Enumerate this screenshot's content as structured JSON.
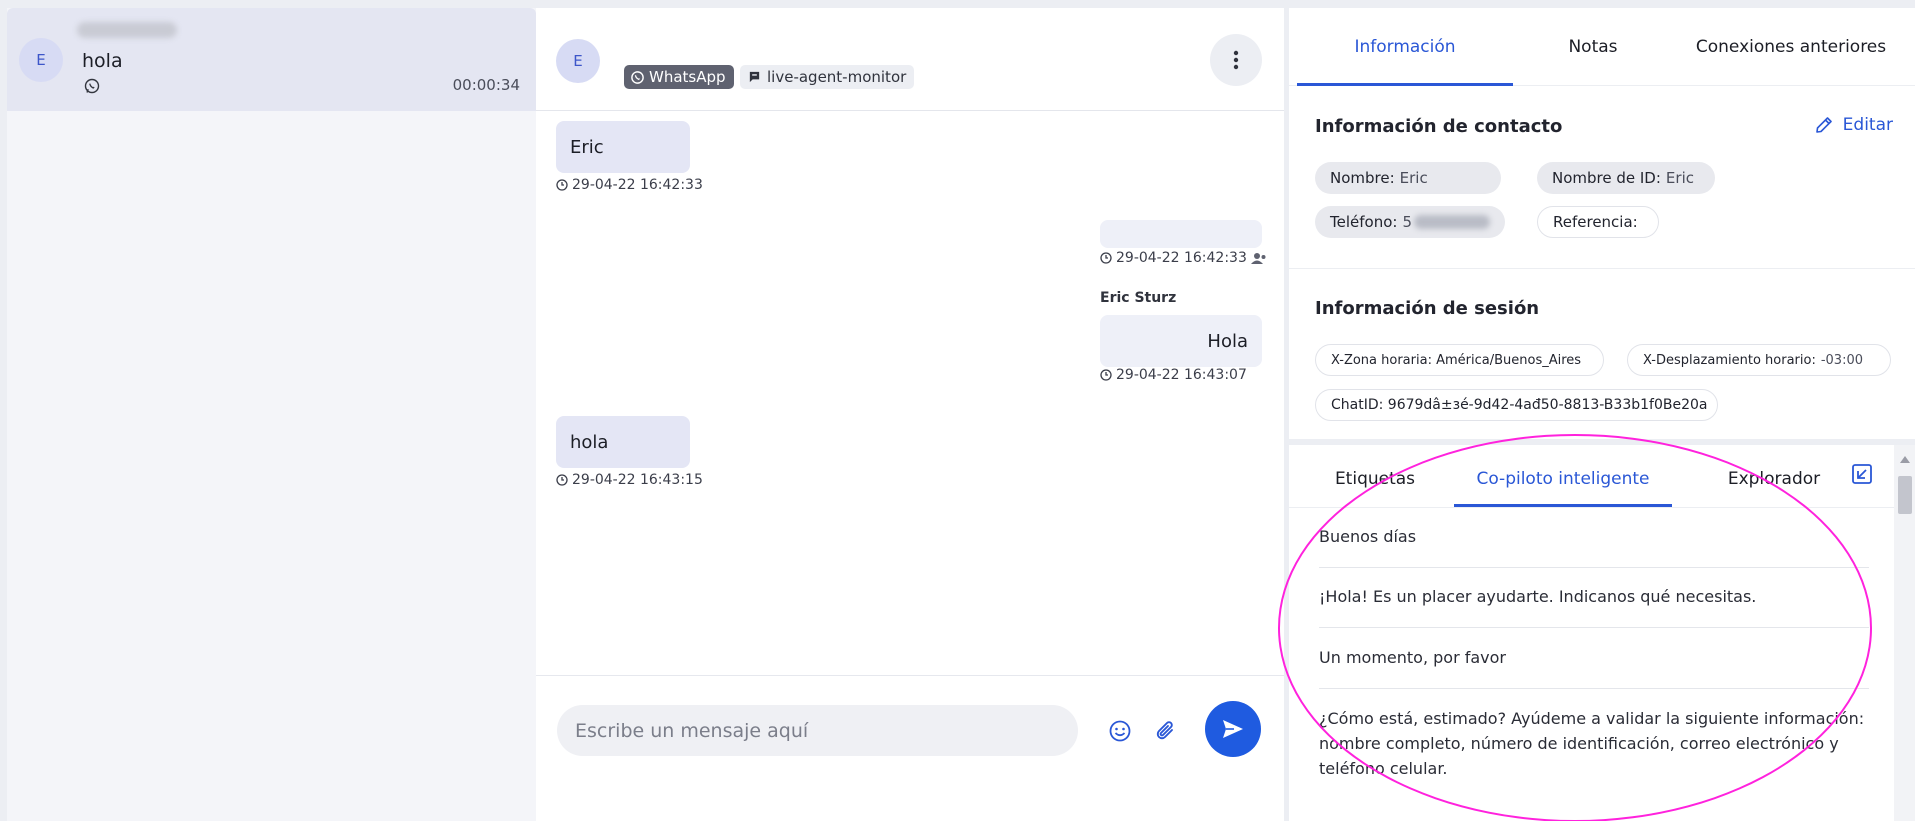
{
  "conversation_list": {
    "item": {
      "avatar_initial": "E",
      "last_message": "hola",
      "duration": "00:00:34",
      "channel_icon": "whatsapp-icon"
    }
  },
  "chat": {
    "header": {
      "avatar_initial": "E",
      "channel_tag": "WhatsApp",
      "monitor_tag": "live-agent-monitor"
    },
    "messages": [
      {
        "direction": "in",
        "text": "Eric",
        "time": "29-04-22 16:42:33"
      },
      {
        "direction": "out",
        "text": "",
        "time": "29-04-22 16:42:33"
      },
      {
        "direction": "out",
        "sender": "Eric Sturz",
        "text": "Hola",
        "time": "29-04-22 16:43:07"
      },
      {
        "direction": "in",
        "text": "hola",
        "time": "29-04-22 16:43:15"
      }
    ],
    "composer": {
      "placeholder": "Escribe un mensaje aquí"
    }
  },
  "details": {
    "tabs": [
      "Información",
      "Notas",
      "Conexiones anteriores"
    ],
    "active_tab": "Información",
    "contact": {
      "title": "Información de contacto",
      "edit_label": "Editar",
      "name_label": "Nombre:",
      "name_value": "Eric",
      "id_name_label": "Nombre de ID:",
      "id_name_value": "Eric",
      "phone_label": "Teléfono:",
      "phone_value": "5",
      "reference_label": "Referencia:",
      "reference_value": ""
    },
    "session": {
      "title": "Información de sesión",
      "timezone": "X-Zona horaria: América/Buenos_Aires",
      "offset_label": "X-Desplazamiento horario:",
      "offset_value": "-03:00",
      "chat_id": "ChatID: 9679dâ±ɜé-9d42-4ađ50-8813-B33b1f0Be20a"
    },
    "bottom_tabs": [
      "Etiquetas",
      "Co-piloto inteligente",
      "Explorador"
    ],
    "active_bottom_tab": "Co-piloto inteligente",
    "suggestions": [
      "Buenos días",
      "¡Hola! Es un placer ayudarte. Indicanos qué necesitas.",
      "Un momento, por favor",
      "¿Cómo está, estimado? Ayúdeme a validar la siguiente información: nombre completo, número de identificación, correo electrónico y teléfono celular."
    ]
  },
  "colors": {
    "accent": "#2a57d6",
    "send_button": "#1f5be0",
    "highlight": "#ff22dd",
    "bubble_in": "#e4e6f5"
  }
}
